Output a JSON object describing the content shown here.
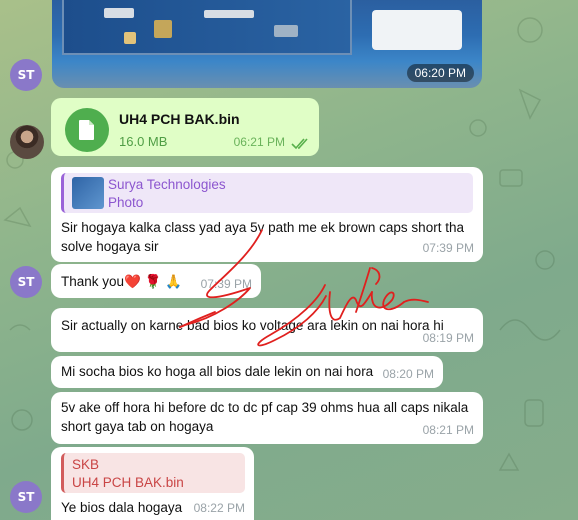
{
  "messages": [
    {
      "sender_initials": "ST",
      "photo_time": "06:20 PM"
    },
    {
      "file_name": "UH4 PCH BAK.bin",
      "file_size": "16.0 MB",
      "time": "06:21 PM"
    },
    {
      "reply_name": "Surya Technologies",
      "reply_type": "Photo",
      "text": "Sir hogaya kalka class yad aya 5v  path me ek brown caps short tha solve hogaya sir",
      "time": "07:39 PM"
    },
    {
      "sender_initials": "ST",
      "text": "Thank you❤️ 🌹 🙏",
      "time": "07:39 PM"
    },
    {
      "text": "Sir actually on karne bad bios ko voltage ara lekin on nai hora hi",
      "time": "08:19 PM"
    },
    {
      "text": "Mi socha bios ko hoga all bios dale lekin on nai hora",
      "time": "08:20 PM"
    },
    {
      "text": "5v ake off hora hi  before dc to dc pf cap 39 ohms hua all caps nikala short gaya tab on hogaya",
      "time": "08:21 PM"
    },
    {
      "sender_initials": "ST",
      "reply_name": "SKB",
      "reply_type": "UH4 PCH BAK.bin",
      "text": "Ye bios dala hogaya",
      "time": "08:22 PM"
    }
  ],
  "colors": {
    "incoming_bubble": "#ffffff",
    "outgoing_bubble": "#e0fec6",
    "avatar": "#8a78c9",
    "file_icon": "#4fae4e",
    "scribble": "#e0201e"
  },
  "icons": {
    "file": "file-icon",
    "read_receipt": "double-check-icon"
  }
}
